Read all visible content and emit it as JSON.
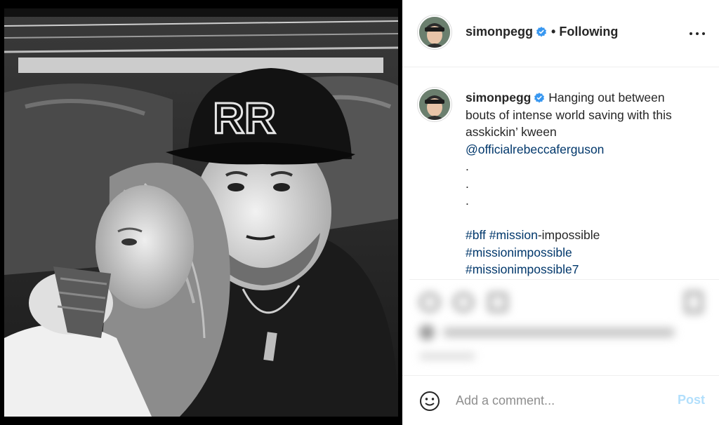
{
  "header": {
    "username": "simonpegg",
    "separator": "•",
    "follow_state": "Following"
  },
  "caption": {
    "username": "simonpegg",
    "text_line1": "Hanging out between",
    "text_line2": "bouts of intense world saving with this",
    "text_line3": "asskickin’ kween",
    "mention": "@officialrebeccaferguson",
    "dot": ".",
    "hashtag1": "#bff",
    "hashtag2": "#mission",
    "hashtag2_rest": "-impossible",
    "hashtag3": "#missionimpossible",
    "hashtag4": "#missionimpossible7"
  },
  "comment": {
    "placeholder": "Add a comment...",
    "post_label": "Post"
  },
  "photo": {
    "cap_logo_text": "RR"
  },
  "colors": {
    "verified": "#3897f0",
    "link": "#00376b",
    "post_disabled": "#b2dffc"
  },
  "icons": [
    "verified-badge-icon",
    "more-options-icon",
    "emoji-icon"
  ]
}
